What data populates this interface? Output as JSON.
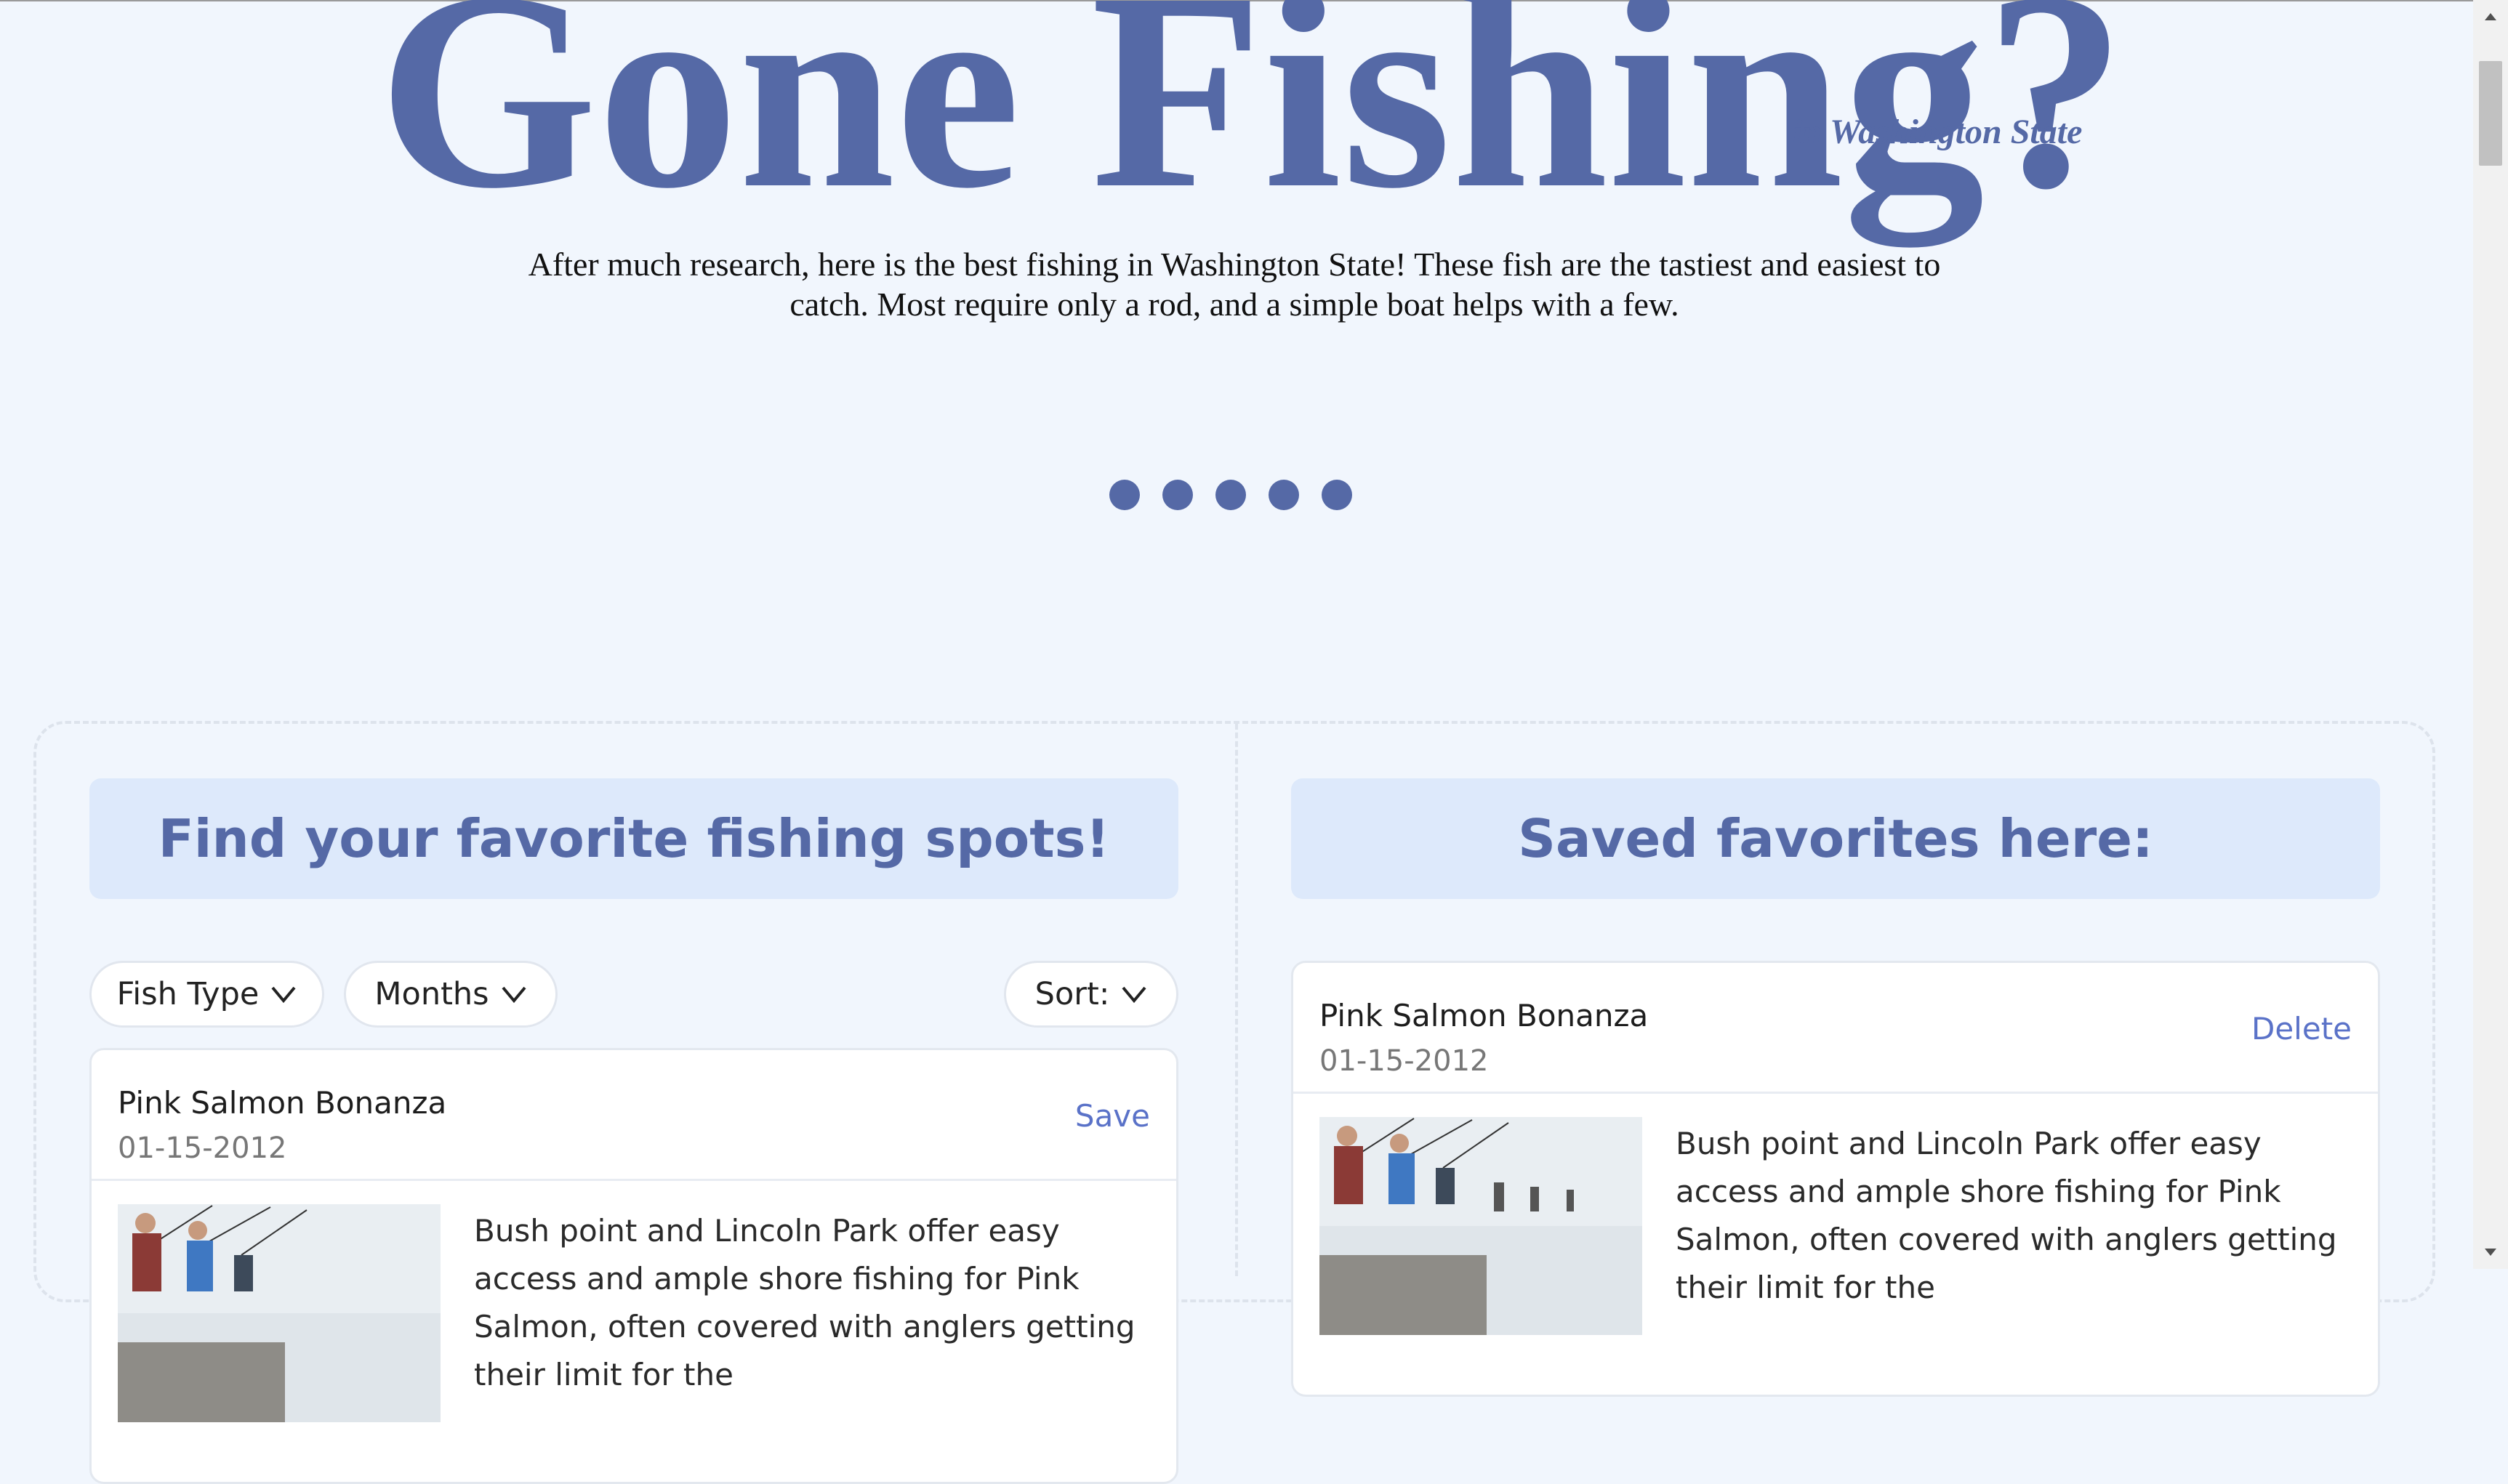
{
  "header": {
    "title": "Gone Fishing?",
    "subtitle": "in Washington State",
    "description": "After much research, here is the best fishing in Washington State! These fish are the tastiest and easiest to catch. Most require only a rod, and a simple boat helps with a few."
  },
  "carousel": {
    "dot_count": 5,
    "dot_color": "#5569a6"
  },
  "left_panel": {
    "heading": "Find your favorite fishing spots!",
    "filters": {
      "fish_type": "Fish Type",
      "months": "Months",
      "sort": "Sort:"
    },
    "cards": [
      {
        "title": "Pink Salmon Bonanza",
        "date": "01-15-2012",
        "action": "Save",
        "image": "anglers-on-beach-photo",
        "text": "Bush point and Lincoln Park offer easy access and ample shore fishing for Pink Salmon, often covered with anglers getting their limit for the"
      }
    ]
  },
  "right_panel": {
    "heading": "Saved favorites here:",
    "cards": [
      {
        "title": "Pink Salmon Bonanza",
        "date": "01-15-2012",
        "action": "Delete",
        "image": "anglers-on-beach-photo",
        "text": "Bush point and Lincoln Park offer easy access and ample shore fishing for Pink Salmon, often covered with anglers getting their limit for the"
      }
    ]
  },
  "colors": {
    "accent": "#5569a6",
    "background": "#f1f6fd",
    "panel_head": "#dde9fb",
    "link": "#5a72c8"
  }
}
